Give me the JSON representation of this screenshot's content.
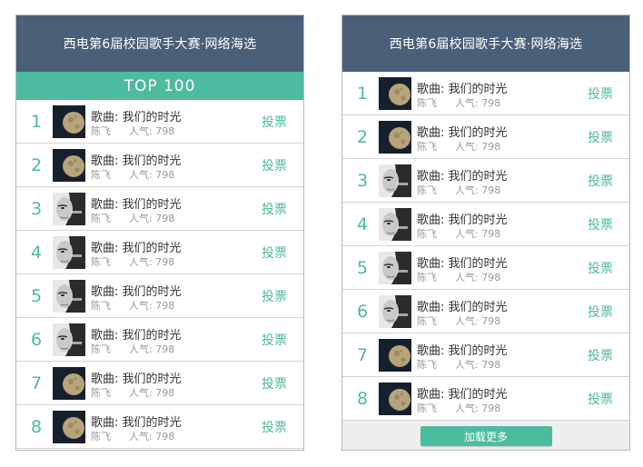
{
  "colors": {
    "header_bg": "#4a5f78",
    "accent": "#4dbb9e",
    "border": "#b9b9b9"
  },
  "left_panel": {
    "title": "西电第6届校园歌手大赛·网络海选",
    "banner": "TOP 100",
    "rows": [
      {
        "rank": "1",
        "thumb": "moon-icon",
        "song": "歌曲: 我们的时光",
        "singer": "陈飞",
        "popularity": "人气: 798",
        "vote": "投票"
      },
      {
        "rank": "2",
        "thumb": "moon-icon",
        "song": "歌曲: 我们的时光",
        "singer": "陈飞",
        "popularity": "人气: 798",
        "vote": "投票"
      },
      {
        "rank": "3",
        "thumb": "portrait-icon",
        "song": "歌曲: 我们的时光",
        "singer": "陈飞",
        "popularity": "人气: 798",
        "vote": "投票"
      },
      {
        "rank": "4",
        "thumb": "portrait-icon",
        "song": "歌曲: 我们的时光",
        "singer": "陈飞",
        "popularity": "人气: 798",
        "vote": "投票"
      },
      {
        "rank": "5",
        "thumb": "portrait-icon",
        "song": "歌曲: 我们的时光",
        "singer": "陈飞",
        "popularity": "人气: 798",
        "vote": "投票"
      },
      {
        "rank": "6",
        "thumb": "portrait-icon",
        "song": "歌曲: 我们的时光",
        "singer": "陈飞",
        "popularity": "人气: 798",
        "vote": "投票"
      },
      {
        "rank": "7",
        "thumb": "moon-icon",
        "song": "歌曲: 我们的时光",
        "singer": "陈飞",
        "popularity": "人气: 798",
        "vote": "投票"
      },
      {
        "rank": "8",
        "thumb": "moon-icon",
        "song": "歌曲: 我们的时光",
        "singer": "陈飞",
        "popularity": "人气: 798",
        "vote": "投票"
      }
    ]
  },
  "right_panel": {
    "title": "西电第6届校园歌手大赛·网络海选",
    "rows": [
      {
        "rank": "1",
        "thumb": "moon-icon",
        "song": "歌曲: 我们的时光",
        "singer": "陈飞",
        "popularity": "人气: 798",
        "vote": "投票"
      },
      {
        "rank": "2",
        "thumb": "moon-icon",
        "song": "歌曲: 我们的时光",
        "singer": "陈飞",
        "popularity": "人气: 798",
        "vote": "投票"
      },
      {
        "rank": "3",
        "thumb": "portrait-icon",
        "song": "歌曲: 我们的时光",
        "singer": "陈飞",
        "popularity": "人气: 798",
        "vote": "投票"
      },
      {
        "rank": "4",
        "thumb": "portrait-icon",
        "song": "歌曲: 我们的时光",
        "singer": "陈飞",
        "popularity": "人气: 798",
        "vote": "投票"
      },
      {
        "rank": "5",
        "thumb": "portrait-icon",
        "song": "歌曲: 我们的时光",
        "singer": "陈飞",
        "popularity": "人气: 798",
        "vote": "投票"
      },
      {
        "rank": "6",
        "thumb": "portrait-icon",
        "song": "歌曲: 我们的时光",
        "singer": "陈飞",
        "popularity": "人气: 798",
        "vote": "投票"
      },
      {
        "rank": "7",
        "thumb": "moon-icon",
        "song": "歌曲: 我们的时光",
        "singer": "陈飞",
        "popularity": "人气: 798",
        "vote": "投票"
      },
      {
        "rank": "8",
        "thumb": "moon-icon",
        "song": "歌曲: 我们的时光",
        "singer": "陈飞",
        "popularity": "人气: 798",
        "vote": "投票"
      }
    ],
    "load_more": "加载更多"
  }
}
